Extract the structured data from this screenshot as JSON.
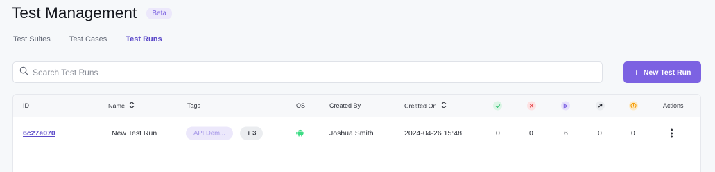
{
  "header": {
    "title": "Test Management",
    "badge": "Beta"
  },
  "tabs": [
    {
      "label": "Test Suites"
    },
    {
      "label": "Test Cases"
    },
    {
      "label": "Test Runs"
    }
  ],
  "search": {
    "placeholder": "Search Test Runs"
  },
  "actions": {
    "new_run_label": "New Test Run"
  },
  "table": {
    "columns": {
      "id": "ID",
      "name": "Name",
      "tags": "Tags",
      "os": "OS",
      "created_by": "Created By",
      "created_on": "Created On",
      "actions": "Actions"
    },
    "status_icons": [
      {
        "icon": "check-icon",
        "color": "#2fbf71"
      },
      {
        "icon": "x-icon",
        "color": "#e5484d"
      },
      {
        "icon": "play-icon",
        "color": "#7c62e2"
      },
      {
        "icon": "arrow-up-right-icon",
        "color": "#22252d"
      },
      {
        "icon": "clock-icon",
        "color": "#f59e0b"
      }
    ],
    "rows": [
      {
        "id": "6c27e070",
        "name": "New Test Run",
        "tag": "API Dem...",
        "tag_more": "+ 3",
        "os": "android-icon",
        "created_by": "Joshua Smith",
        "created_on": "2024-04-26 15:48",
        "counts": [
          "0",
          "0",
          "6",
          "0",
          "0"
        ]
      }
    ]
  }
}
